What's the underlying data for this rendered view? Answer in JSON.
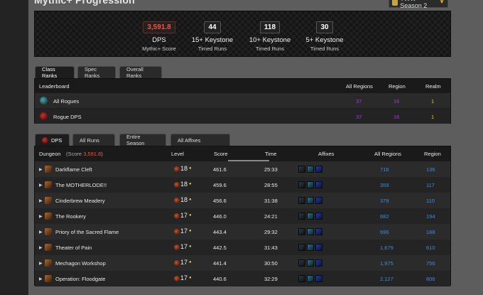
{
  "header": {
    "title": "Mythic+ Progression",
    "season_label": "TWW Season 2"
  },
  "banner": {
    "stats": [
      {
        "value": "3,591.8",
        "label": "DPS",
        "sub": "Mythic+ Score",
        "highlight": true
      },
      {
        "value": "44",
        "label": "15+ Keystone",
        "sub": "Timed Runs"
      },
      {
        "value": "118",
        "label": "10+ Keystone",
        "sub": "Timed Runs"
      },
      {
        "value": "30",
        "label": "5+ Keystone",
        "sub": "Timed Runs"
      }
    ]
  },
  "rank_tabs": [
    "Class Ranks",
    "Spec Ranks",
    "Overall Ranks"
  ],
  "leaderboard": {
    "headers": {
      "name": "Leaderboard",
      "all_regions": "All Regions",
      "region": "Region",
      "realm": "Realm"
    },
    "rows": [
      {
        "name": "All Rogues",
        "all_regions": "37",
        "region": "16",
        "realm": "1"
      },
      {
        "name": "Rogue DPS",
        "all_regions": "37",
        "region": "16",
        "realm": "1"
      }
    ]
  },
  "run_tabs": [
    "DPS",
    "All Runs",
    "Entire Season",
    "All Affixes"
  ],
  "runs": {
    "headers": {
      "dungeon": "Dungeon",
      "score_prefix": "(Score",
      "score_value": "3,591.8",
      "score_suffix": ")",
      "level": "Level",
      "score": "Score",
      "time": "Time",
      "affixes": "Affixes",
      "all_regions": "All Regions",
      "region": "Region"
    },
    "rows": [
      {
        "dungeon": "Darkflame Cleft",
        "level": "18",
        "score": "461.6",
        "time": "25:33",
        "all_regions": "716",
        "region": "136"
      },
      {
        "dungeon": "The MOTHERLODE!!",
        "level": "18",
        "score": "459.6",
        "time": "28:55",
        "all_regions": "359",
        "region": "117"
      },
      {
        "dungeon": "Cinderbrew Meadery",
        "level": "18",
        "score": "456.6",
        "time": "31:38",
        "all_regions": "379",
        "region": "110"
      },
      {
        "dungeon": "The Rookery",
        "level": "17",
        "score": "446.0",
        "time": "24:21",
        "all_regions": "682",
        "region": "194"
      },
      {
        "dungeon": "Priory of the Sacred Flame",
        "level": "17",
        "score": "443.4",
        "time": "29:32",
        "all_regions": "696",
        "region": "188"
      },
      {
        "dungeon": "Theater of Pain",
        "level": "17",
        "score": "442.5",
        "time": "31:43",
        "all_regions": "1,679",
        "region": "610"
      },
      {
        "dungeon": "Mechagon Workshop",
        "level": "17",
        "score": "441.4",
        "time": "30:50",
        "all_regions": "1,975",
        "region": "756"
      },
      {
        "dungeon": "Operation: Floodgate",
        "level": "17",
        "score": "440.6",
        "time": "32:29",
        "all_regions": "2,127",
        "region": "806"
      }
    ]
  }
}
